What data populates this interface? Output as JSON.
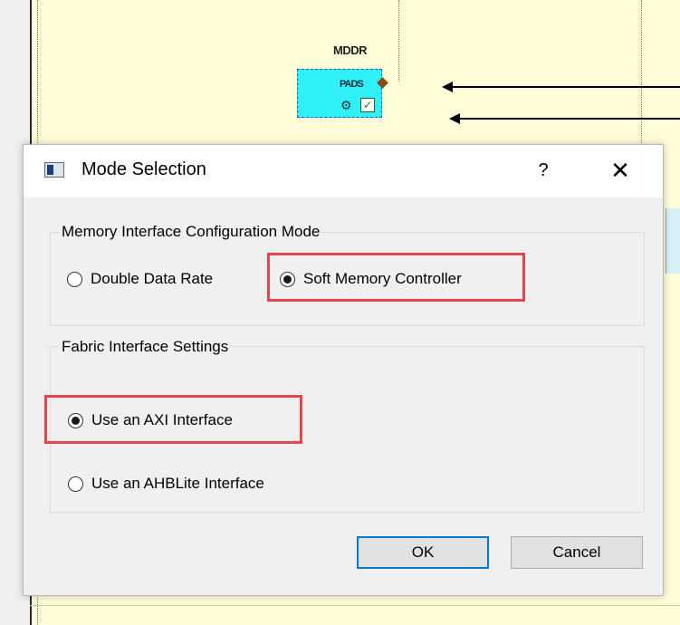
{
  "canvas": {
    "block_title": "MDDR",
    "pads_label": "PADS"
  },
  "dialog": {
    "title": "Mode Selection",
    "help_label": "?",
    "close_label": "✕",
    "memory_group": {
      "label": "Memory Interface Configuration Mode",
      "options": [
        {
          "label": "Double Data Rate",
          "checked": false
        },
        {
          "label": "Soft Memory Controller",
          "checked": true
        }
      ]
    },
    "fabric_group": {
      "label": "Fabric Interface Settings",
      "options": [
        {
          "label": "Use an AXI Interface",
          "checked": true
        },
        {
          "label": "Use an AHBLite Interface",
          "checked": false
        }
      ]
    },
    "ok_label": "OK",
    "cancel_label": "Cancel"
  },
  "colors": {
    "canvas_bg": "#fffdd8",
    "block_fill": "#2ff0f7",
    "highlight": "#e8454a",
    "default_button_border": "#0078d7"
  },
  "icons": {
    "app": "app-window-icon",
    "gear": "gear-icon",
    "check": "check-icon"
  }
}
